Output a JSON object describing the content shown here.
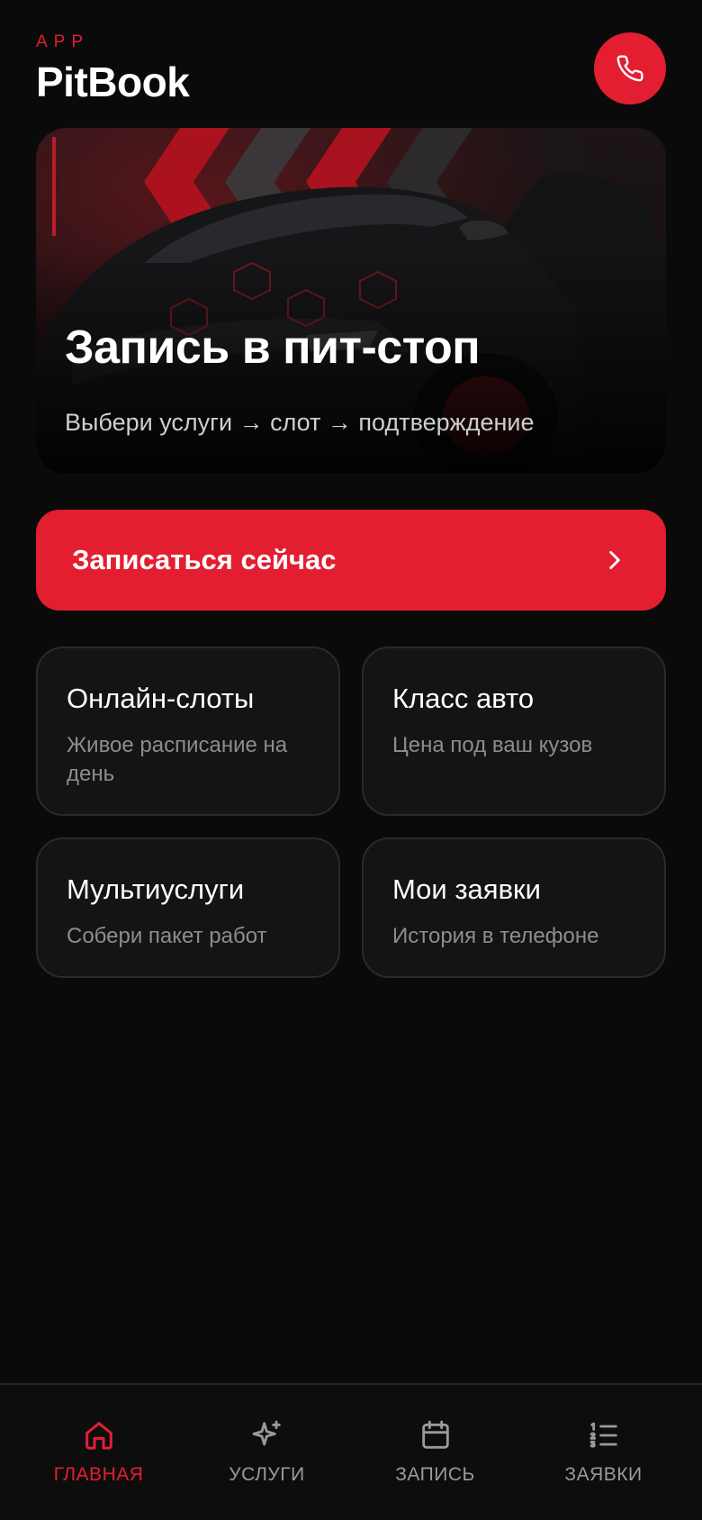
{
  "brand": {
    "eyebrow": "APP",
    "title": "PitBook"
  },
  "header": {
    "call_icon": "phone-icon",
    "accent_color": "#e31e31"
  },
  "hero": {
    "title": "Запись в пит-стоп",
    "subtitle": "Выбери услуги → слот → подтверждение",
    "image_subject": "car-detailing-photo"
  },
  "cta": {
    "label": "Записаться сейчас",
    "icon": "chevron-right-icon"
  },
  "features": [
    {
      "title": "Онлайн-слоты",
      "desc": "Живое расписание на день"
    },
    {
      "title": "Класс авто",
      "desc": "Цена под ваш кузов"
    },
    {
      "title": "Мультиуслуги",
      "desc": "Собери пакет работ"
    },
    {
      "title": "Мои заявки",
      "desc": "История в телефоне"
    }
  ],
  "nav": {
    "active": "home",
    "items": [
      {
        "key": "home",
        "label": "ГЛАВНАЯ",
        "icon": "home-icon"
      },
      {
        "key": "services",
        "label": "УСЛУГИ",
        "icon": "sparkle-icon"
      },
      {
        "key": "booking",
        "label": "ЗАПИСЬ",
        "icon": "calendar-icon"
      },
      {
        "key": "requests",
        "label": "ЗАЯВКИ",
        "icon": "numbered-list-icon"
      }
    ]
  },
  "colors": {
    "background": "#0a0a0a",
    "accent": "#e31e31",
    "card": "#141414",
    "muted": "#8d8d8d"
  }
}
